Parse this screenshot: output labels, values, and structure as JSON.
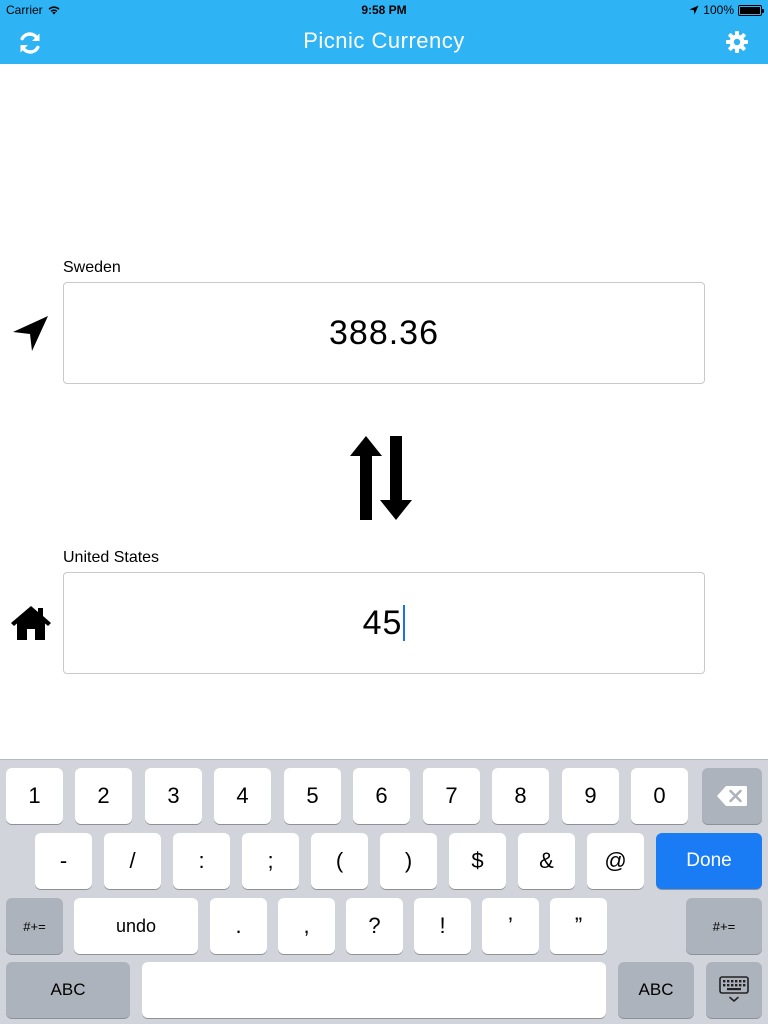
{
  "status_bar": {
    "carrier": "Carrier",
    "time": "9:58 PM",
    "battery": "100%"
  },
  "nav": {
    "title": "Picnic Currency",
    "refresh_icon": "refresh-icon",
    "settings_icon": "gear-icon"
  },
  "converter": {
    "top": {
      "country": "Sweden",
      "value": "388.36",
      "icon": "location-arrow-icon"
    },
    "bottom": {
      "country": "United States",
      "value": "45",
      "icon": "home-icon"
    },
    "swap_icon": "swap-arrows-icon"
  },
  "keyboard": {
    "row1": [
      "1",
      "2",
      "3",
      "4",
      "5",
      "6",
      "7",
      "8",
      "9",
      "0"
    ],
    "row2": [
      "-",
      "/",
      ":",
      ";",
      "(",
      ")",
      "$",
      "&",
      "@"
    ],
    "done": "Done",
    "row3_left": "#+=",
    "undo": "undo",
    "row3": [
      ".",
      ",",
      "?",
      "!",
      "’",
      "”"
    ],
    "row3_right": "#+=",
    "abc_left": "ABC",
    "abc_right": "ABC"
  },
  "colors": {
    "nav_bar": "#2eb3f5",
    "done_key": "#1a7cf5",
    "keyboard_bg": "#d1d5db"
  }
}
